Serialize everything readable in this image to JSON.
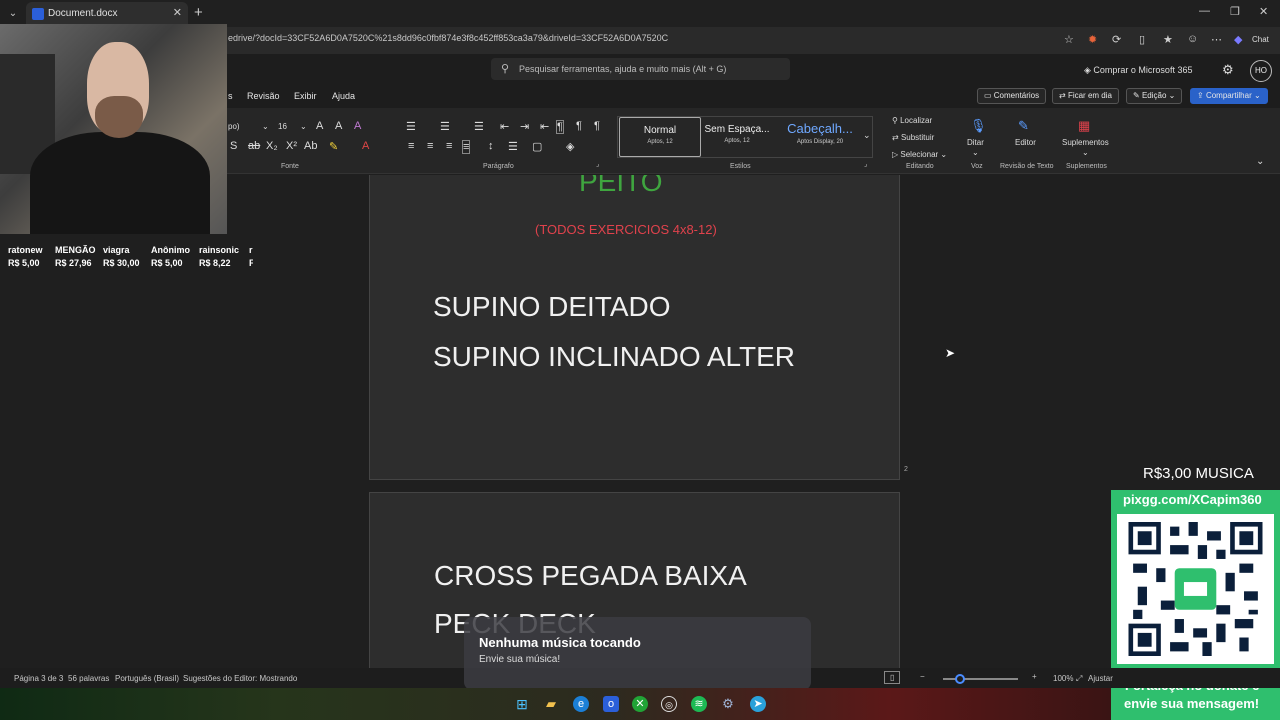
{
  "browser": {
    "tab_title": "Document.docx",
    "url": "edrive/?docId=33CF52A6D0A7520C%21s8dd96c0fbf874e3f8c452ff853ca3a79&driveId=33CF52A6D0A7520C",
    "chat_label": "Chat"
  },
  "word_header": {
    "search_placeholder": "Pesquisar ferramentas, ajuda e muito mais (Alt + G)",
    "buy_label": "Comprar o Microsoft 365",
    "avatar_initials": "HO"
  },
  "menu": {
    "partial_tab": "s",
    "items": [
      "Revisão",
      "Exibir",
      "Ajuda"
    ],
    "comments": "Comentários",
    "catch_up": "Ficar em dia",
    "editing": "Edição",
    "share": "Compartilhar"
  },
  "ribbon": {
    "font_name": "po)",
    "font_size": "16",
    "groups": {
      "font": "Fonte",
      "paragraph": "Parágrafo",
      "styles": "Estilos",
      "editing": "Editando",
      "voice": "Voz",
      "text_review": "Revisão de Texto",
      "addins": "Suplementos"
    },
    "styles": [
      {
        "name": "Normal",
        "sub": "Aptos, 12"
      },
      {
        "name": "Sem Espaça...",
        "sub": "Aptos, 12"
      },
      {
        "name": "Cabeçalh...",
        "sub": "Aptos Display, 20"
      }
    ],
    "find": "Localizar",
    "replace": "Substituir",
    "select": "Selecionar",
    "dictate": "Ditar",
    "editor": "Editor",
    "addins_btn": "Suplementos"
  },
  "document": {
    "heading": "PEITO",
    "subheading": "(TODOS EXERCICIOS 4x8-12)",
    "page3_lines": [
      "SUPINO DEITADO",
      "SUPINO INCLINADO ALTER"
    ],
    "page_number": "2",
    "page4_lines": [
      "CROSS PEGADA BAIXA",
      "PECK DECK"
    ]
  },
  "donations": [
    {
      "name": "ratonew",
      "amount": "R$ 5,00"
    },
    {
      "name": "MENGÃO",
      "amount": "R$ 27,96"
    },
    {
      "name": "viagra",
      "amount": "R$ 30,00"
    },
    {
      "name": "Anônimo",
      "amount": "R$ 5,00"
    },
    {
      "name": "rainsonic",
      "amount": "R$ 8,22"
    },
    {
      "name": "r",
      "amount": "F"
    }
  ],
  "overlay": {
    "music_price": "R$3,00 MUSICA",
    "pix_url": "pixgg.com/XCapim360",
    "footer_line1": "Fortaleça no donate e",
    "footer_line2": "envie sua mensagem!",
    "accent_color": "#2fbf6e"
  },
  "toast": {
    "title": "Nenhuma música tocando",
    "subtitle": "Envie sua música!"
  },
  "status": {
    "page": "Página 3 de 3",
    "words": "56 palavras",
    "language": "Português (Brasil)",
    "suggestions": "Sugestões do Editor: Mostrando",
    "zoom": "100%",
    "fit": "Ajustar"
  },
  "colors": {
    "heading": "#3fa53f",
    "subheading": "#e0424c",
    "share_button": "#2a62c9"
  }
}
